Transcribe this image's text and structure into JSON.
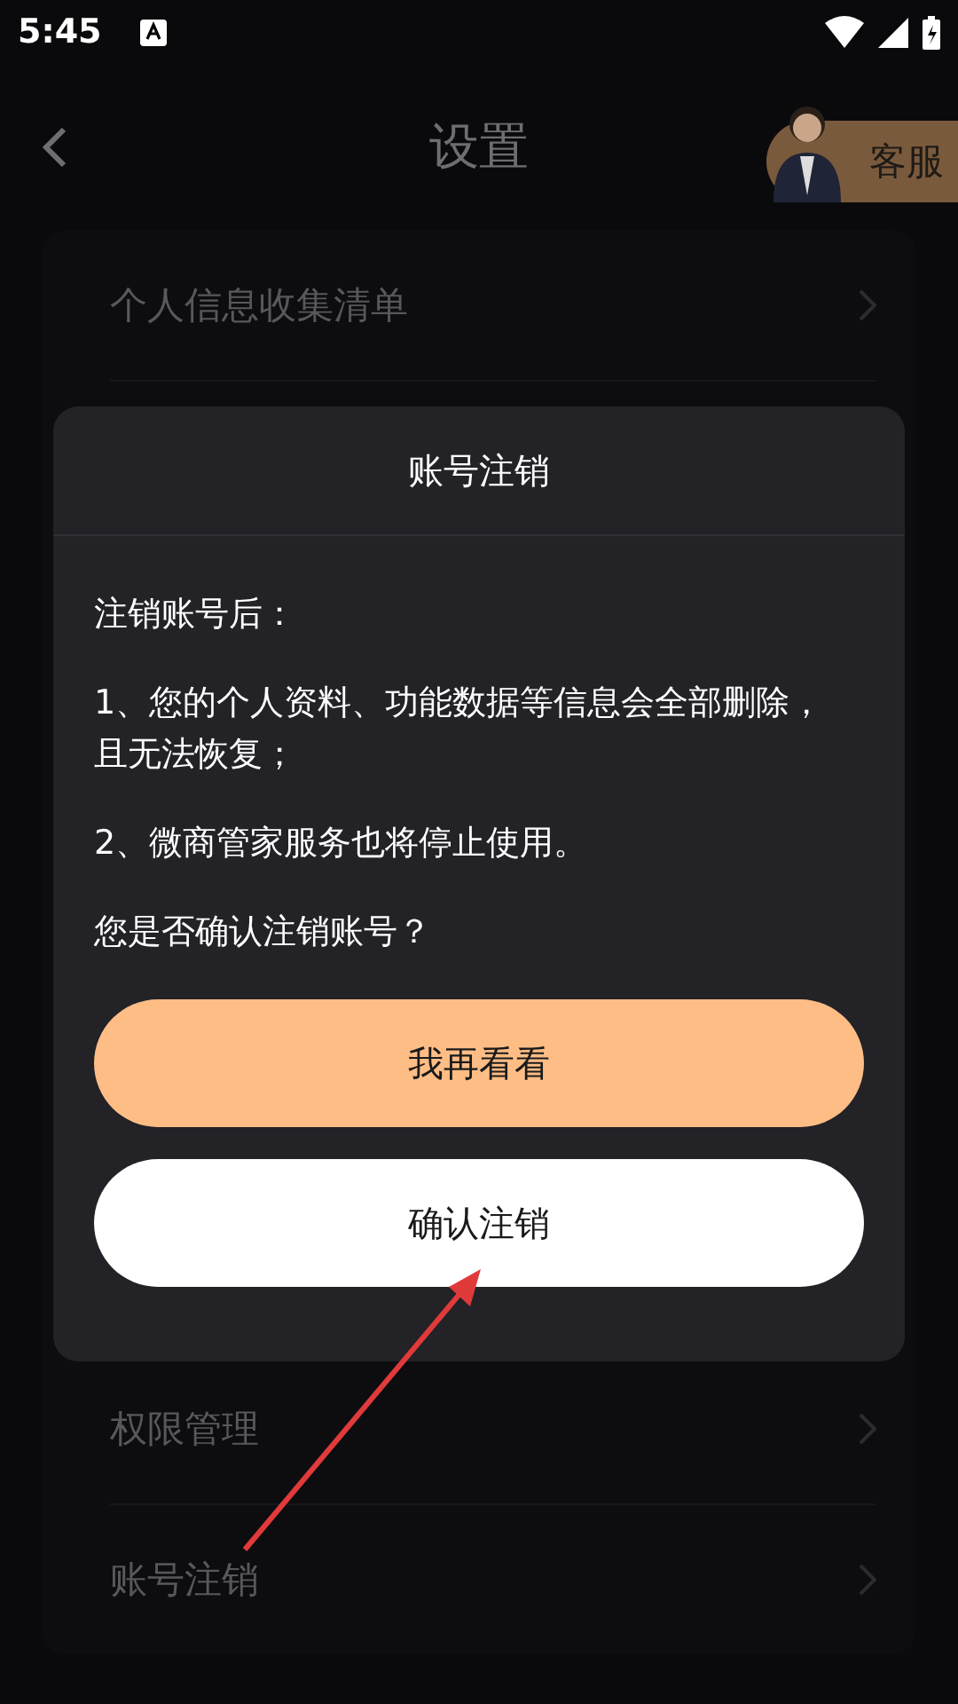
{
  "status_bar": {
    "time": "5:45"
  },
  "header": {
    "title": "设置",
    "service_label": "客服"
  },
  "settings_top": [
    {
      "label": "个人信息收集清单"
    }
  ],
  "settings_bottom": [
    {
      "label": "权限管理"
    },
    {
      "label": "账号注销"
    }
  ],
  "dialog": {
    "title": "账号注销",
    "paragraphs": [
      "注销账号后：",
      "1、您的个人资料、功能数据等信息会全部删除，且无法恢复；",
      "2、微商管家服务也将停止使用。",
      "您是否确认注销账号？"
    ],
    "buttons": [
      {
        "label": "我再看看",
        "kind": "primary"
      },
      {
        "label": "确认注销",
        "kind": "secondary"
      }
    ]
  }
}
